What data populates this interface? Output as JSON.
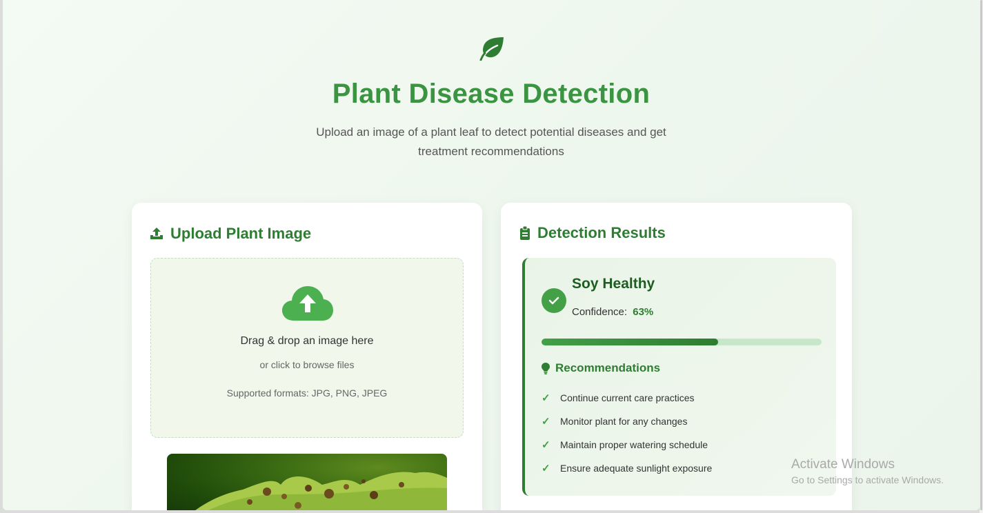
{
  "header": {
    "logo_icon": "leaf-icon",
    "title": "Plant Disease Detection",
    "subtitle": "Upload an image of a plant leaf to detect potential diseases and get treatment recommendations"
  },
  "upload": {
    "title_icon": "upload-icon",
    "title": "Upload Plant Image",
    "drop_icon": "cloud-upload-icon",
    "drop_main": "Drag & drop an image here",
    "drop_sub": "or click to browse files",
    "formats": "Supported formats: JPG, PNG, JPEG"
  },
  "results": {
    "title_icon": "clipboard-icon",
    "title": "Detection Results",
    "status_icon": "check-circle-icon",
    "name": "Soy Healthy",
    "confidence_label": "Confidence:",
    "confidence_value": "63%",
    "confidence_fraction": 0.63,
    "recommendations_icon": "lightbulb-icon",
    "recommendations_title": "Recommendations",
    "recommendations": [
      "Continue current care practices",
      "Monitor plant for any changes",
      "Maintain proper watering schedule",
      "Ensure adequate sunlight exposure"
    ],
    "check_mark": "✓"
  },
  "watermark": {
    "title": "Activate Windows",
    "subtitle": "Go to Settings to activate Windows."
  },
  "colors": {
    "accent": "#3b9441",
    "dark_green": "#2e7d32",
    "light_green": "#c8e6c9"
  }
}
